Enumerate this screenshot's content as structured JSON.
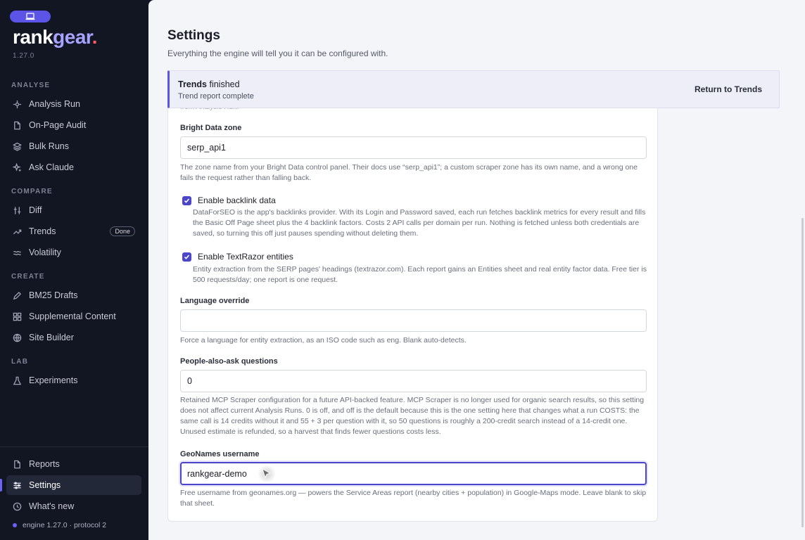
{
  "sidebar": {
    "brand": {
      "part1": "rank",
      "part2": "gear",
      "dot": "."
    },
    "version": "1.27.0",
    "sections": {
      "analyse": "ANALYSE",
      "compare": "COMPARE",
      "create": "CREATE",
      "lab": "LAB"
    },
    "items": {
      "analysis_run": "Analysis Run",
      "on_page_audit": "On-Page Audit",
      "bulk_runs": "Bulk Runs",
      "ask_claude": "Ask Claude",
      "diff": "Diff",
      "trends": "Trends",
      "trends_badge": "Done",
      "volatility": "Volatility",
      "bm25_drafts": "BM25 Drafts",
      "supplemental_content": "Supplemental Content",
      "site_builder": "Site Builder",
      "experiments": "Experiments",
      "reports": "Reports",
      "settings": "Settings",
      "whats_new": "What's new"
    },
    "engine_status": "engine 1.27.0 · protocol 2"
  },
  "page": {
    "title": "Settings",
    "subtitle": "Everything the engine will tell you it can be configured with."
  },
  "toast": {
    "title_bold": "Trends",
    "title_rest": " finished",
    "subtitle": "Trend report complete",
    "action": "Return to Trends"
  },
  "form": {
    "faded_top": "from Analysis Run.",
    "bright_data": {
      "label": "Bright Data zone",
      "value": "serp_api1",
      "help": "The zone name from your Bright Data control panel. Their docs use “serp_api1”; a custom scraper zone has its own name, and a wrong one fails the request rather than falling back."
    },
    "backlinks": {
      "label": "Enable backlink data",
      "help": "DataForSEO is the app's backlinks provider. With its Login and Password saved, each run fetches backlink metrics for every result and fills the Basic Off Page sheet plus the 4 backlink factors. Costs 2 API calls per domain per run. Nothing is fetched unless both credentials are saved, so turning this off just pauses spending without deleting them."
    },
    "textrazor": {
      "label": "Enable TextRazor entities",
      "help": "Entity extraction from the SERP pages' headings (textrazor.com). Each report gains an Entities sheet and real entity factor data. Free tier is 500 requests/day; one report is one request."
    },
    "language": {
      "label": "Language override",
      "value": "",
      "help": "Force a language for entity extraction, as an ISO code such as eng. Blank auto-detects."
    },
    "paa": {
      "label": "People-also-ask questions",
      "value": "0",
      "help": "Retained MCP Scraper configuration for a future API-backed feature. MCP Scraper is no longer used for organic search results, so this setting does not affect current Analysis Runs. 0 is off, and off is the default because this is the one setting here that changes what a run COSTS: the same call is 14 credits without it and 55 + 3 per question with it, so 50 questions is roughly a 200-credit search instead of a 14-credit one. Unused estimate is refunded, so a harvest that finds fewer questions costs less."
    },
    "geonames": {
      "label": "GeoNames username",
      "value": "rankgear-demo",
      "help": "Free username from geonames.org — powers the Service Areas report (nearby cities + population) in Google-Maps mode. Leave blank to skip that sheet."
    }
  },
  "colors": {
    "accent": "#5b54e6",
    "sidebar_bg": "#121522",
    "main_bg": "#f4f5f8",
    "brand_dot": "#ff5a5f"
  }
}
